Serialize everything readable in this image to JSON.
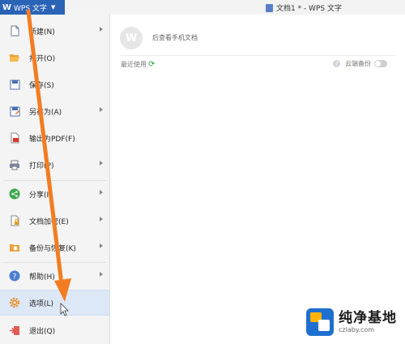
{
  "titlebar": {
    "app_label": "WPS 文字",
    "app_logo": "W",
    "doc_title": "文档1 * - WPS 文字"
  },
  "menu": {
    "items": [
      {
        "label": "新建(N)",
        "icon": "new-document-icon",
        "has_submenu": true
      },
      {
        "label": "打开(O)",
        "icon": "open-folder-icon",
        "has_submenu": false
      },
      {
        "label": "保存(S)",
        "icon": "save-icon",
        "has_submenu": false
      },
      {
        "label": "另存为(A)",
        "icon": "save-as-icon",
        "has_submenu": true
      },
      {
        "label": "输出为PDF(F)",
        "icon": "pdf-icon",
        "has_submenu": false
      },
      {
        "label": "打印(P)",
        "icon": "print-icon",
        "has_submenu": true
      },
      {
        "label": "分享(I)",
        "icon": "share-icon",
        "has_submenu": true
      },
      {
        "label": "文档加密(E)",
        "icon": "encrypt-icon",
        "has_submenu": true
      },
      {
        "label": "备份与恢复(K)",
        "icon": "backup-icon",
        "has_submenu": true
      },
      {
        "label": "帮助(H)",
        "icon": "help-icon",
        "has_submenu": true
      },
      {
        "label": "选项(L)",
        "icon": "gear-icon",
        "has_submenu": false,
        "active": true
      },
      {
        "label": "退出(Q)",
        "icon": "exit-icon",
        "has_submenu": false
      }
    ]
  },
  "panel": {
    "phone_link": "后查看手机文档",
    "phone_logo": "W",
    "recent_label": "最近使用",
    "cloud_backup_label": "云端备份",
    "cloud_backup_on": false
  },
  "watermark": {
    "title": "纯净基地",
    "url": "czlaby.com"
  },
  "colors": {
    "accent": "#2b63b6",
    "annotation_arrow": "#f47c20",
    "selected_bg": "#dde8f6"
  }
}
